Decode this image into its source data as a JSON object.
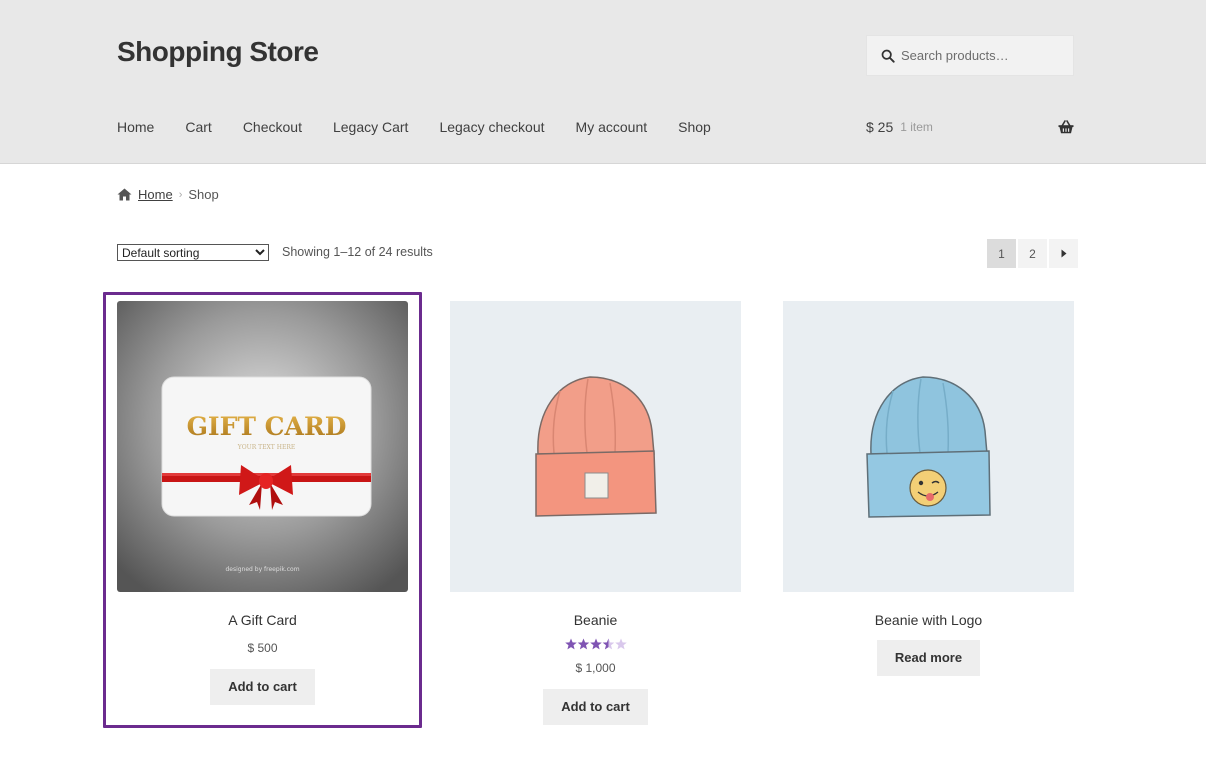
{
  "site": {
    "title": "Shopping Store"
  },
  "search": {
    "placeholder": "Search products…",
    "icon": "search-icon"
  },
  "nav": {
    "items": [
      {
        "label": "Home"
      },
      {
        "label": "Cart"
      },
      {
        "label": "Checkout"
      },
      {
        "label": "Legacy Cart"
      },
      {
        "label": "Legacy checkout"
      },
      {
        "label": "My account"
      },
      {
        "label": "Shop"
      }
    ]
  },
  "mini_cart": {
    "amount": "$ 25",
    "count": "1 item",
    "icon": "basket-icon"
  },
  "breadcrumb": {
    "home": "Home",
    "current": "Shop",
    "separator": "›"
  },
  "sorting": {
    "selected": "Default sorting"
  },
  "result_count": "Showing 1–12 of 24 results",
  "pagination": {
    "pages": [
      "1",
      "2"
    ],
    "current": "1"
  },
  "products": [
    {
      "name": "A Gift Card",
      "price": "$ 500",
      "button": "Add to cart",
      "image_title": "GIFT CARD",
      "image_subtitle": "YOUR TEXT HERE",
      "image_credit": "designed by freepik.com"
    },
    {
      "name": "Beanie",
      "price": "$ 1,000",
      "button": "Add to cart",
      "rating": 3.5,
      "rating_max": 5
    },
    {
      "name": "Beanie with Logo",
      "button": "Read more"
    }
  ],
  "colors": {
    "header_bg": "#e8e8e8",
    "accent_purple": "#7f54b3",
    "focus_ring": "#6b2b8e",
    "button_bg": "#eeeeee"
  }
}
